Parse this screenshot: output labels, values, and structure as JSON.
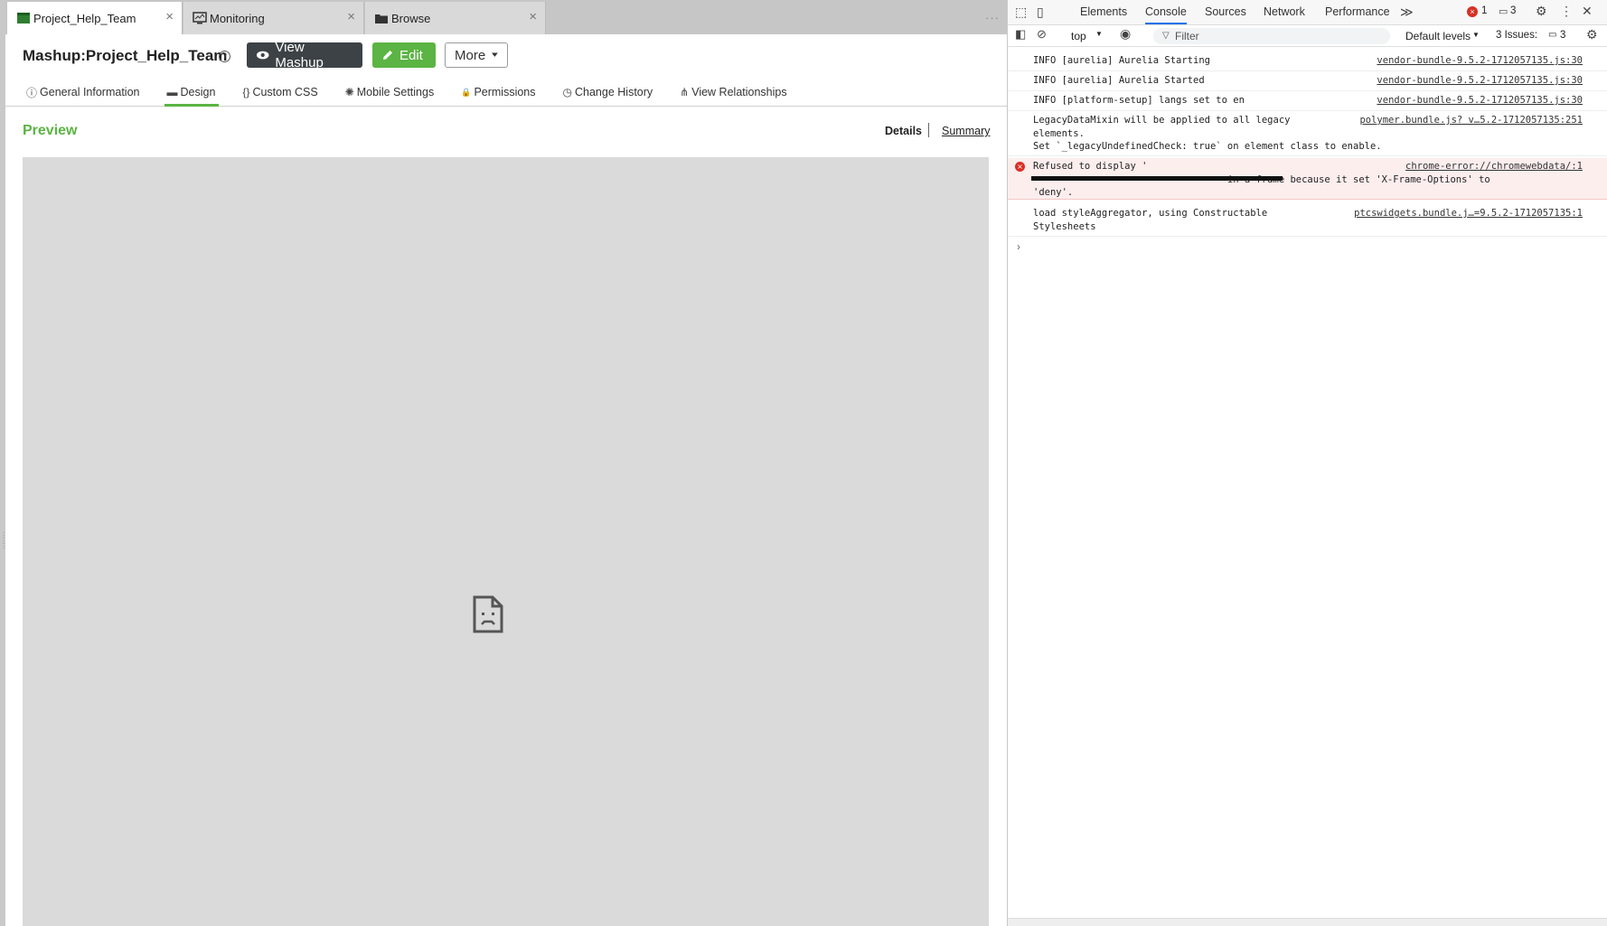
{
  "app_tabs": [
    {
      "label": "Project_Help_Team",
      "close": "×"
    },
    {
      "label": "Monitoring",
      "close": "×"
    },
    {
      "label": "Browse",
      "close": "×"
    }
  ],
  "tab_overflow": "···",
  "header": {
    "title": "Mashup:Project_Help_Team",
    "help": "?",
    "view_button": "View Mashup",
    "edit_button": "Edit",
    "more_button": "More"
  },
  "subtabs": [
    {
      "label": "General Information",
      "icon": "ⓘ"
    },
    {
      "label": "Design",
      "icon": "▬"
    },
    {
      "label": "Custom CSS",
      "icon": "{}"
    },
    {
      "label": "Mobile Settings",
      "icon": "✺"
    },
    {
      "label": "Permissions",
      "icon": "🔒"
    },
    {
      "label": "Change History",
      "icon": "◷"
    },
    {
      "label": "View Relationships",
      "icon": "⋔"
    }
  ],
  "preview": {
    "title": "Preview",
    "details": "Details",
    "summary": "Summary"
  },
  "devtools": {
    "tabs": [
      "Elements",
      "Console",
      "Sources",
      "Network",
      "Performance"
    ],
    "more_tabs": "≫",
    "error_count": "1",
    "message_count": "3",
    "context": "top",
    "filter_placeholder": "Filter",
    "levels": "Default levels",
    "issues_label": "3 Issues:",
    "issues_count": "3",
    "console": [
      {
        "msg": "INFO [aurelia] Aurelia Starting",
        "src": "vendor-bundle-9.5.2-1712057135.js:30"
      },
      {
        "msg": "INFO [aurelia] Aurelia Started",
        "src": "vendor-bundle-9.5.2-1712057135.js:30"
      },
      {
        "msg": "INFO [platform-setup] langs set to en",
        "src": "vendor-bundle-9.5.2-1712057135.js:30"
      },
      {
        "msg": "LegacyDataMixin will be applied to all legacy\nelements.\nSet `_legacyUndefinedCheck: true` on element class to enable.",
        "src": "polymer.bundle.js? v…5.2-1712057135:251"
      },
      {
        "msg": "Refused to display '\n                                  in a frame because it set 'X-Frame-Options' to\n'deny'.",
        "src": "chrome-error://chromewebdata/:1"
      },
      {
        "msg": "load styleAggregator, using Constructable\nStylesheets",
        "src": "ptcswidgets.bundle.j…=9.5.2-1712057135:1"
      }
    ],
    "prompt": "›"
  }
}
